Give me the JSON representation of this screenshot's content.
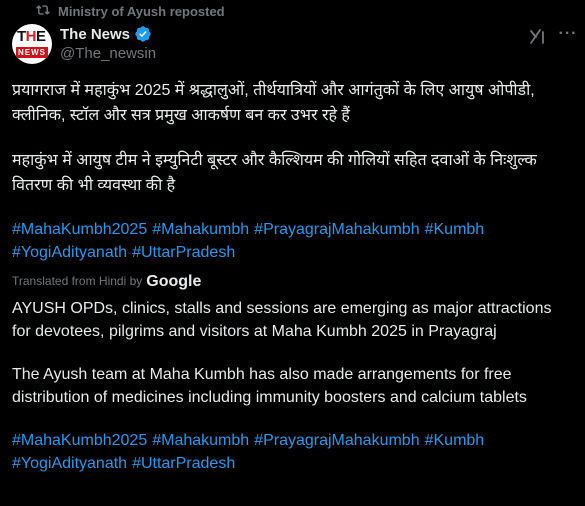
{
  "repost": {
    "label": "Ministry of Ayush reposted",
    "icon": "repost-icon"
  },
  "author": {
    "name": "The News",
    "handle": "@The_newsin",
    "avatar_text_top": "THE",
    "avatar_text_bottom": "NEWS",
    "verified": true
  },
  "icons": {
    "verified": "verified-badge-icon",
    "grok": "grok-icon",
    "more": "more-icon"
  },
  "original": {
    "para1": "प्रयागराज में महाकुंभ 2025 में श्रद्धालुओं, तीर्थयात्रियों और आगंतुकों के लिए आयुष ओपीडी, क्लीनिक, स्टॉल और सत्र प्रमुख आकर्षण बन कर उभर रहे हैं",
    "para2": "महाकुंभ में आयुष टीम ने इम्युनिटी बूस्टर और कैल्शियम की गोलियों सहित दवाओं के निःशुल्क वितरण की भी व्यवस्था की है",
    "hashtags": [
      "#MahaKumbh2025",
      "#Mahakumbh",
      "#PrayagrajMahakumbh",
      "#Kumbh",
      "#YogiAdityanath",
      "#UttarPradesh"
    ]
  },
  "translation": {
    "label": "Translated from Hindi by",
    "provider": "Google",
    "para1": "AYUSH OPDs, clinics, stalls and sessions are emerging as major attractions for devotees, pilgrims and visitors at Maha Kumbh 2025 in Prayagraj",
    "para2": "The Ayush team at Maha Kumbh has also made arrangements for free distribution of medicines including immunity boosters and calcium tablets",
    "hashtags": [
      "#MahaKumbh2025",
      "#Mahakumbh",
      "#PrayagrajMahakumbh",
      "#Kumbh",
      "#YogiAdityanath",
      "#UttarPradesh"
    ]
  },
  "colors": {
    "background": "#000000",
    "text": "#e7e9ea",
    "muted": "#71767b",
    "link": "#1d9bf0",
    "verified": "#1d9bf0"
  }
}
